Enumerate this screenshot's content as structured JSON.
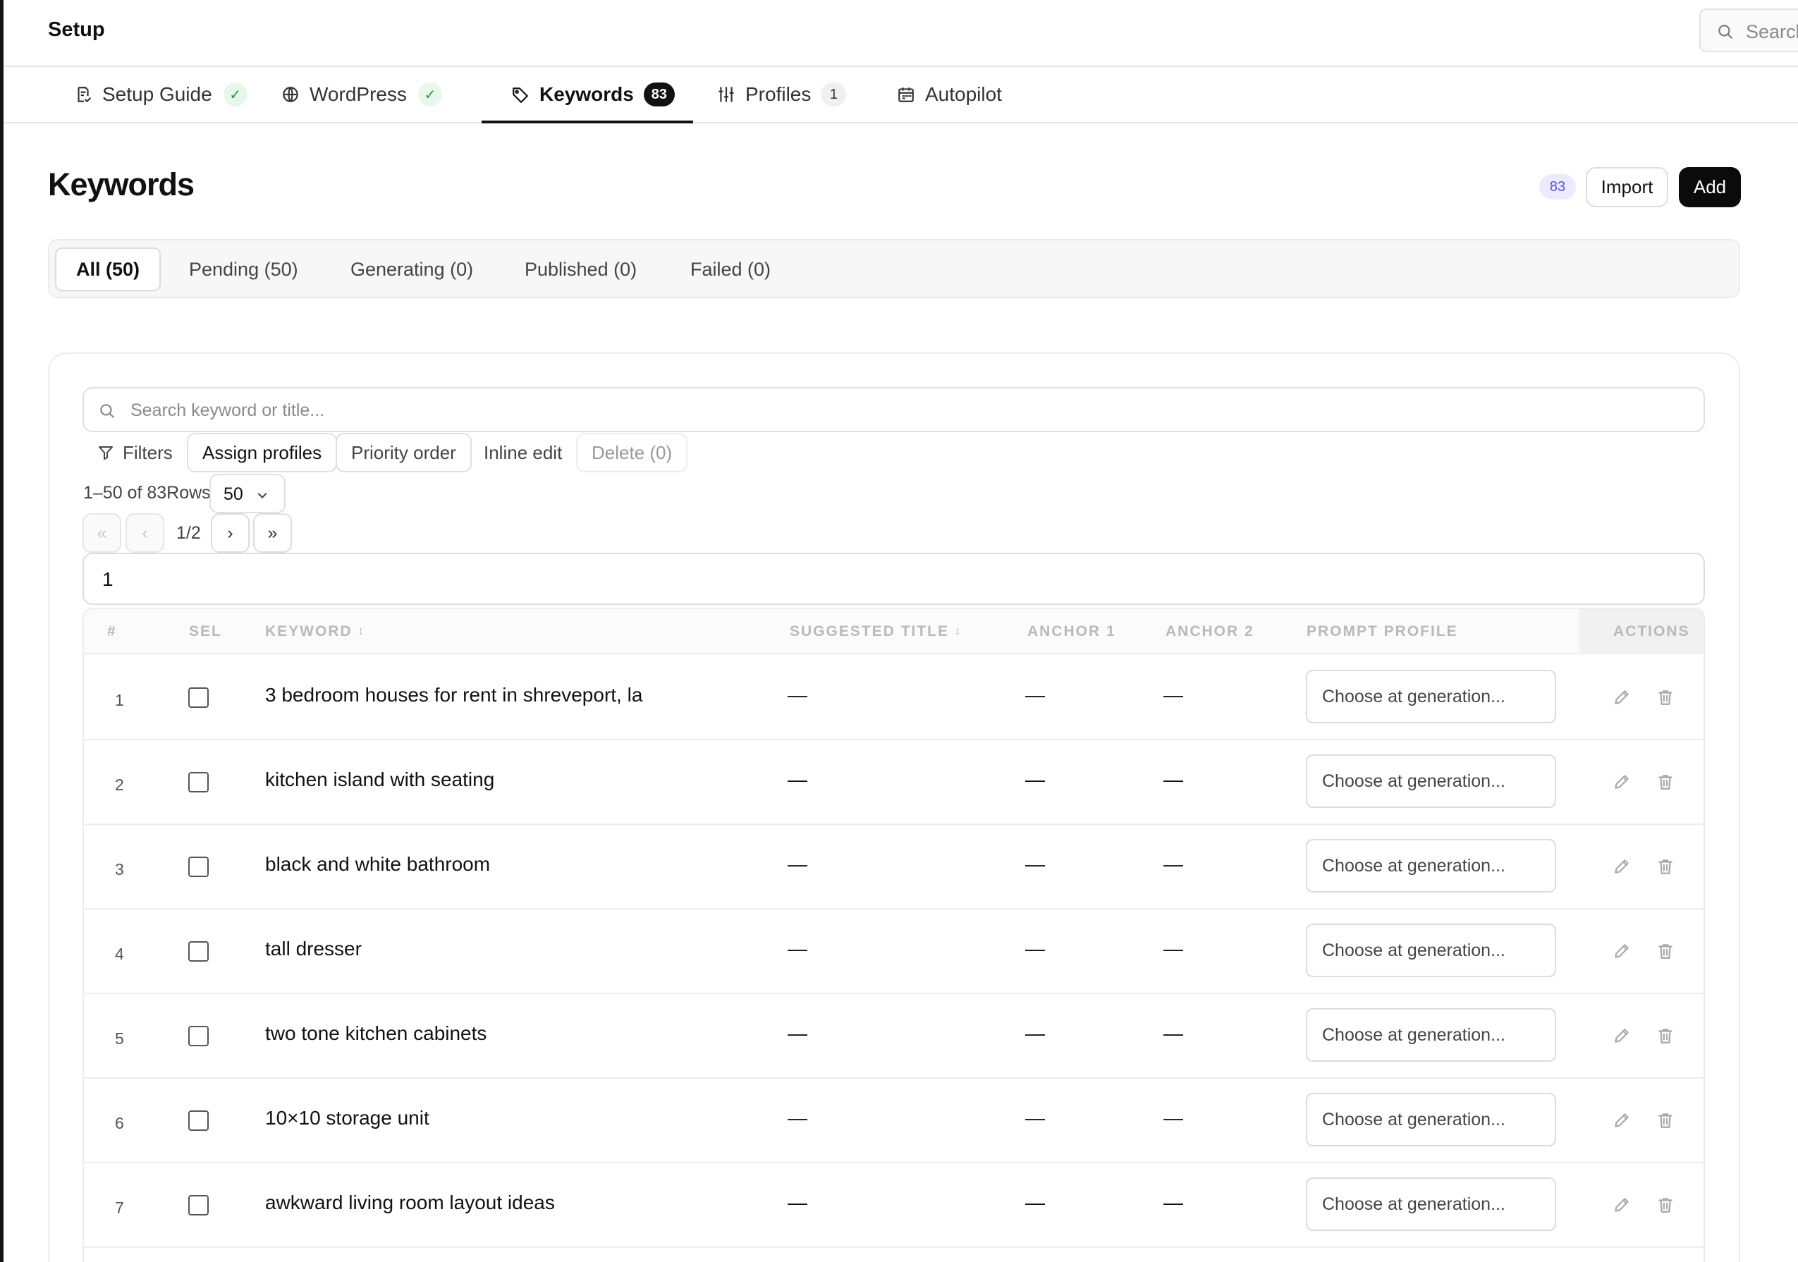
{
  "app": {
    "title": "Setup"
  },
  "global_search": {
    "placeholder": "Search"
  },
  "nav_tabs": [
    {
      "label": "Setup Guide",
      "icon": "doc-check-icon",
      "status": "✓"
    },
    {
      "label": "WordPress",
      "icon": "globe-icon",
      "status": "✓"
    },
    {
      "label": "Keywords",
      "icon": "tag-icon",
      "count": "83",
      "active": true
    },
    {
      "label": "Profiles",
      "icon": "sliders-icon",
      "count": "1"
    },
    {
      "label": "Autopilot",
      "icon": "calendar-icon"
    }
  ],
  "page": {
    "title": "Keywords",
    "count_badge": "83",
    "import_label": "Import",
    "add_label": "Add"
  },
  "status_tabs": [
    {
      "label": "All (50)",
      "active": true
    },
    {
      "label": "Pending (50)"
    },
    {
      "label": "Generating (0)"
    },
    {
      "label": "Published (0)"
    },
    {
      "label": "Failed (0)"
    }
  ],
  "table_search": {
    "placeholder": "Search keyword or title..."
  },
  "toolbar": {
    "filters": "Filters",
    "assign_profiles": "Assign profiles",
    "priority_order": "Priority order",
    "inline_edit": "Inline edit",
    "delete": "Delete (0)"
  },
  "pagination": {
    "range": "1–50 of 83",
    "rows_label": "Rows",
    "rows_value": "50",
    "first": "«",
    "prev": "‹",
    "page_text": "1/2",
    "next": "›",
    "last": "»",
    "page_input_value": "1"
  },
  "table": {
    "headers": {
      "num": "#",
      "sel": "SEL",
      "keyword": "KEYWORD",
      "suggested_title": "SUGGESTED TITLE",
      "anchor1": "ANCHOR 1",
      "anchor2": "ANCHOR 2",
      "prompt_profile": "PROMPT PROFILE",
      "actions": "ACTIONS",
      "sort_glyph": "↕"
    },
    "rows": [
      {
        "num": "1",
        "keyword": "3 bedroom houses for rent in shreveport, la",
        "suggested_title": "—",
        "anchor1": "—",
        "anchor2": "—",
        "profile": "Choose at generation..."
      },
      {
        "num": "2",
        "keyword": "kitchen island with seating",
        "suggested_title": "—",
        "anchor1": "—",
        "anchor2": "—",
        "profile": "Choose at generation..."
      },
      {
        "num": "3",
        "keyword": "black and white bathroom",
        "suggested_title": "—",
        "anchor1": "—",
        "anchor2": "—",
        "profile": "Choose at generation..."
      },
      {
        "num": "4",
        "keyword": "tall dresser",
        "suggested_title": "—",
        "anchor1": "—",
        "anchor2": "—",
        "profile": "Choose at generation..."
      },
      {
        "num": "5",
        "keyword": "two tone kitchen cabinets",
        "suggested_title": "—",
        "anchor1": "—",
        "anchor2": "—",
        "profile": "Choose at generation..."
      },
      {
        "num": "6",
        "keyword": "10×10 storage unit",
        "suggested_title": "—",
        "anchor1": "—",
        "anchor2": "—",
        "profile": "Choose at generation..."
      },
      {
        "num": "7",
        "keyword": "awkward living room layout ideas",
        "suggested_title": "—",
        "anchor1": "—",
        "anchor2": "—",
        "profile": "Choose at generation..."
      }
    ]
  },
  "colors": {
    "accent_dark": "#0b0b0b",
    "check_green": "#1f9a43",
    "count_purple": "#5b55d6"
  }
}
